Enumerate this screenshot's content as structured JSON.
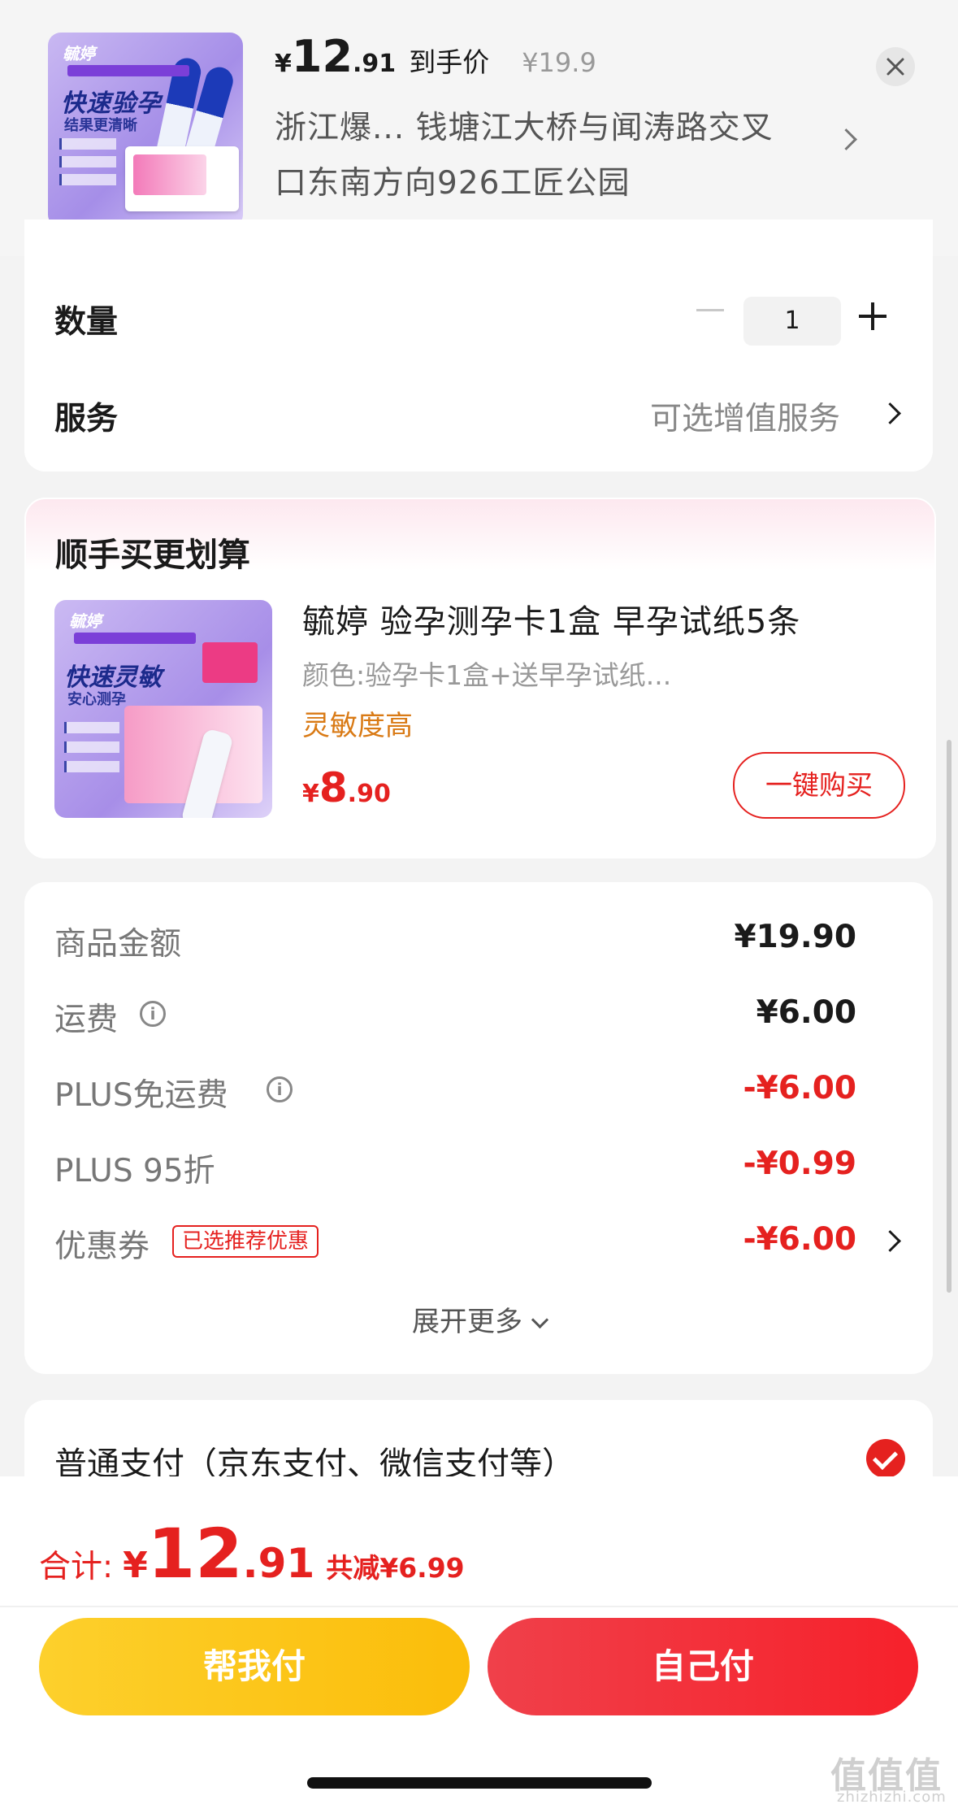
{
  "header": {
    "currency": "¥",
    "price_int": "12",
    "price_dec": ".91",
    "price_tag": "到手价",
    "original_price": "¥19.9",
    "address_line1": "浙江爆...  钱塘江大桥与闻涛路交叉",
    "address_line2": "口东南方向926工匠公园",
    "thumb_brand": "毓婷",
    "thumb_title": "快速验孕",
    "thumb_sub": "结果更清晰"
  },
  "quantity": {
    "label": "数量",
    "value": "1"
  },
  "service": {
    "label": "服务",
    "value": "可选增值服务"
  },
  "combo": {
    "title": "顺手买更划算",
    "thumb_title": "快速灵敏",
    "thumb_sub": "安心测孕",
    "name": "毓婷 验孕测孕卡1盒 早孕试纸5条",
    "spec": "颜色:验孕卡1盒+送早孕试纸...",
    "tag": "灵敏度高",
    "price_currency": "¥",
    "price_int": "8",
    "price_dec": ".90",
    "buy_label": "一键购买"
  },
  "amounts": {
    "rows": [
      {
        "label": "商品金额",
        "value": "¥19.90"
      },
      {
        "label": "运费",
        "value": "¥6.00"
      },
      {
        "label": "PLUS免运费",
        "value": "-¥6.00"
      },
      {
        "label": "PLUS 95折",
        "value": "-¥0.99"
      },
      {
        "label": "优惠券",
        "value": "-¥6.00"
      }
    ],
    "coupon_badge": "已选推荐优惠",
    "expand_label": "展开更多"
  },
  "payment": {
    "label": "普通支付（京东支付、微信支付等）"
  },
  "total": {
    "label": "合计:",
    "currency": "¥",
    "price_int": "12",
    "price_dec": ".91",
    "save_label": "共减¥6.99"
  },
  "buttons": {
    "help_pay": "帮我付",
    "self_pay": "自己付"
  },
  "watermark": {
    "main": "值值值",
    "sub": "zhizhizhi.com"
  },
  "colors": {
    "accent_red": "#e5211f",
    "accent_yellow": "#fdd02c",
    "tag_orange": "#d97a15"
  }
}
